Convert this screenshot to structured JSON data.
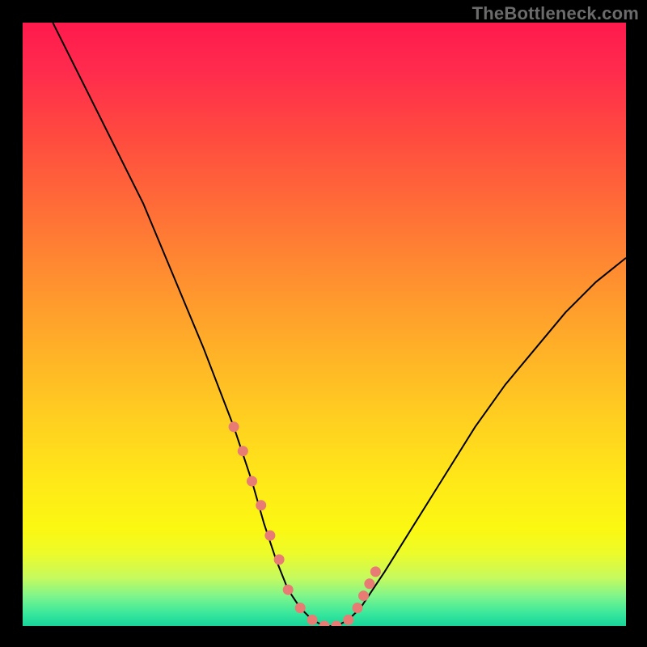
{
  "watermark": "TheBottleneck.com",
  "chart_data": {
    "type": "line",
    "title": "",
    "xlabel": "",
    "ylabel": "",
    "xlim": [
      0,
      100
    ],
    "ylim": [
      0,
      100
    ],
    "series": [
      {
        "name": "bottleneck-curve",
        "x": [
          5,
          10,
          15,
          20,
          25,
          30,
          35,
          38,
          40,
          42,
          44,
          46,
          48,
          50,
          52,
          54,
          56,
          60,
          65,
          70,
          75,
          80,
          85,
          90,
          95,
          100
        ],
        "y": [
          100,
          90,
          80,
          70,
          58,
          46,
          33,
          24,
          17,
          11,
          6,
          3,
          1,
          0,
          0,
          1,
          3,
          9,
          17,
          25,
          33,
          40,
          46,
          52,
          57,
          61
        ]
      }
    ],
    "highlight_points": {
      "name": "sample-dots",
      "x": [
        35,
        36.5,
        38,
        39.5,
        41,
        42.5,
        44,
        46,
        48,
        50,
        52,
        54,
        55.5,
        56.5,
        57.5,
        58.5
      ],
      "y": [
        33,
        29,
        24,
        20,
        15,
        11,
        6,
        3,
        1,
        0,
        0,
        1,
        3,
        5,
        7,
        9
      ],
      "color": "#e87b74"
    },
    "background": {
      "gradient_top": "#ff1a4d",
      "gradient_bottom": "#18d49a"
    }
  }
}
